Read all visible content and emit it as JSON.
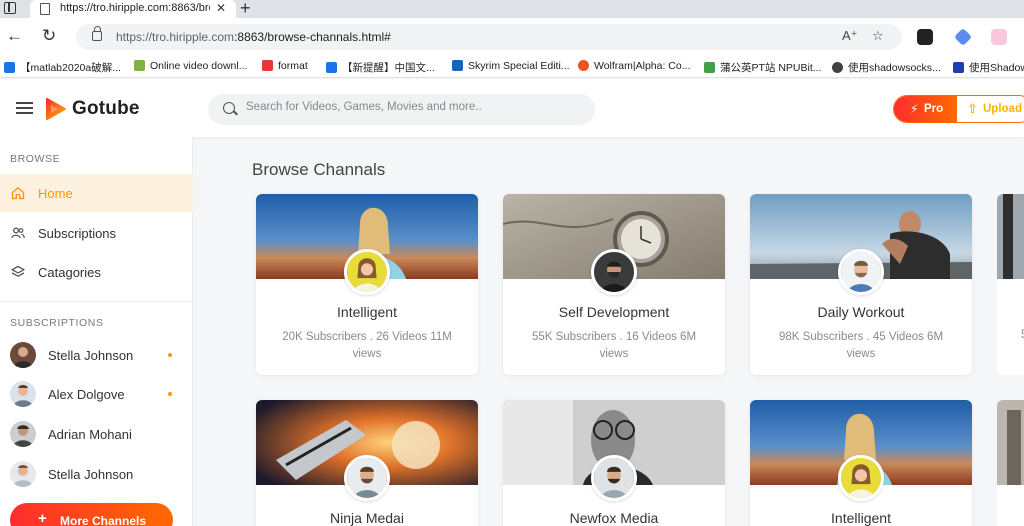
{
  "browser": {
    "tab_title": "https://tro.hiripple.com:8863/bro",
    "tab_close": "✕",
    "new_tab": "+",
    "url_host": "https://tro.hiripple.com",
    "url_path": ":8863/browse-channals.html#",
    "bookmarks": [
      {
        "label": "【matlab2020a破解...",
        "color": "#1a73e8"
      },
      {
        "label": "Online video downl...",
        "color": "#7cb342"
      },
      {
        "label": "format",
        "color": "#e53935"
      },
      {
        "label": "【新提醒】中国文...",
        "color": "#1a73e8"
      },
      {
        "label": "Skyrim Special Editi...",
        "color": "#1565c0"
      },
      {
        "label": "Wolfram|Alpha: Co...",
        "color": "#f4511e"
      },
      {
        "label": "蒲公英PT站 NPUBit...",
        "color": "#43a047"
      },
      {
        "label": "使用shadowsocks...",
        "color": "#424242"
      },
      {
        "label": "使用Shadow",
        "color": "#1e40af"
      }
    ]
  },
  "header": {
    "logo_text": "Gotube",
    "search_placeholder": "Search for Videos, Games, Movies and more..",
    "pro_label": "Pro",
    "upload_label": "Upload"
  },
  "sidebar": {
    "browse_heading": "BROWSE",
    "items": [
      {
        "label": "Home",
        "icon": "home-icon"
      },
      {
        "label": "Subscriptions",
        "icon": "users-icon"
      },
      {
        "label": "Catagories",
        "icon": "layers-icon"
      }
    ],
    "subscriptions_heading": "SUBSCRIPTIONS",
    "subscriptions": [
      {
        "name": "Stella Johnson",
        "has_dot": true
      },
      {
        "name": "Alex Dolgove",
        "has_dot": true
      },
      {
        "name": "Adrian Mohani",
        "has_dot": false
      },
      {
        "name": "Stella Johnson",
        "has_dot": false
      }
    ],
    "more_label": "More Channels"
  },
  "main": {
    "title": "Browse Channals",
    "channels": [
      {
        "name": "Intelligent",
        "meta": "20K Subscribers . 26 Videos 11M views"
      },
      {
        "name": "Self Development",
        "meta": "55K Subscribers . 16 Videos 6M views"
      },
      {
        "name": "Daily Workout",
        "meta": "98K Subscribers . 45 Videos 6M views"
      },
      {
        "name": "Ninja Medai",
        "meta": ""
      },
      {
        "name": "Newfox Media",
        "meta": ""
      },
      {
        "name": "Intelligent",
        "meta": ""
      }
    ],
    "peek_meta_fragment": "5"
  },
  "colors": {
    "accent_orange": "#ff9800",
    "gradient_start": "#ff2d2d",
    "gradient_end": "#ff6a00",
    "active_bg": "#fdf1df"
  }
}
